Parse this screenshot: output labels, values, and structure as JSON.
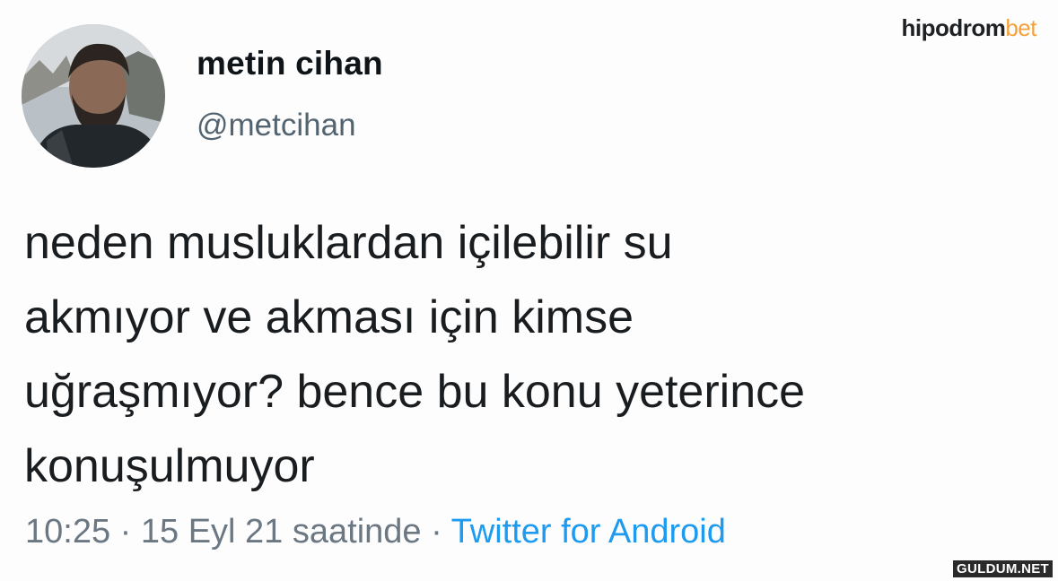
{
  "author": {
    "display_name": "metin cihan",
    "handle": "@metcihan",
    "avatar_icon": "profile-photo"
  },
  "brand": {
    "part1": "hipodrom",
    "part2": "bet",
    "colors": {
      "dark": "#1f2225",
      "accent": "#f5a13a"
    }
  },
  "tweet": {
    "lines": [
      "neden musluklardan içilebilir su",
      "akmıyor ve akması için kimse",
      "uğraşmıyor? bence bu konu yeterince",
      "konuşulmuyor"
    ]
  },
  "meta": {
    "time": "10:25",
    "separator": "·",
    "date": "15 Eyl 21 saatinde",
    "source": "Twitter for Android",
    "source_color": "#1d9bf0"
  },
  "watermark": "GULDUM.NET"
}
